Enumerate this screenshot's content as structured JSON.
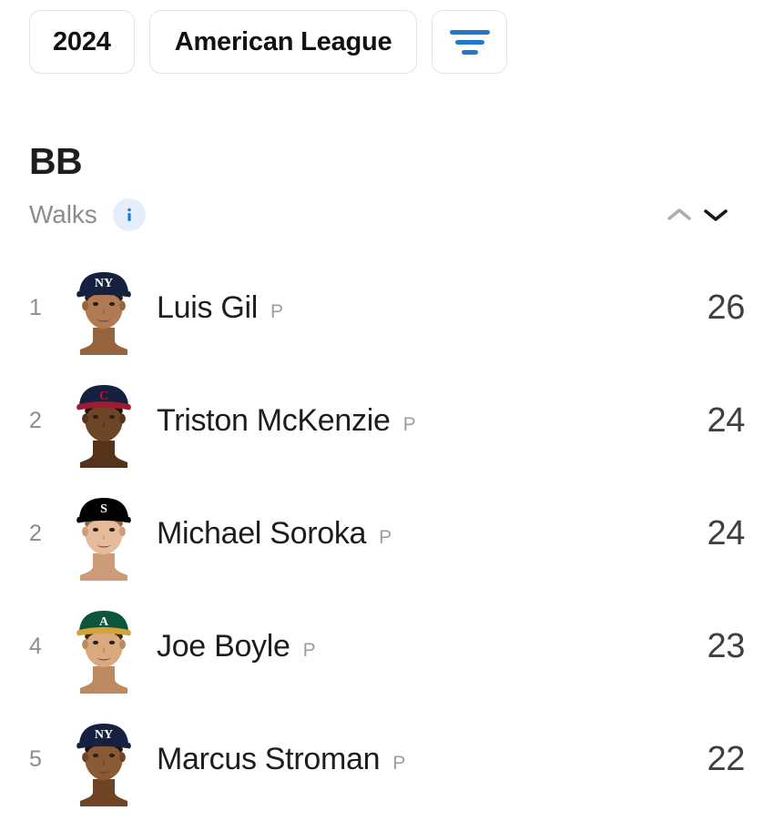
{
  "filters": {
    "season": "2024",
    "league": "American League",
    "filter_icon": "filter-icon"
  },
  "stat": {
    "abbr": "BB",
    "name": "Walks",
    "info_icon": "info-icon",
    "sort_asc_icon": "chevron-up-icon",
    "sort_desc_icon": "chevron-down-icon"
  },
  "leaders": [
    {
      "rank": "1",
      "name": "Luis Gil",
      "position": "P",
      "value": "26",
      "team": "New York Yankees",
      "cap": {
        "crown": "#16213f",
        "brim": "#16213f",
        "logo": "#ffffff",
        "logo_text": "NY"
      },
      "skin": "#b07a53",
      "skin_shadow": "#96643f",
      "hair": "#2b1d14"
    },
    {
      "rank": "2",
      "name": "Triston McKenzie",
      "position": "P",
      "value": "24",
      "team": "Cleveland Guardians",
      "cap": {
        "crown": "#16213f",
        "brim": "#9e1b32",
        "logo": "#c8102e",
        "logo_text": "C"
      },
      "skin": "#6d4527",
      "skin_shadow": "#55331b",
      "hair": "#1a1008"
    },
    {
      "rank": "2",
      "name": "Michael Soroka",
      "position": "P",
      "value": "24",
      "team": "Chicago White Sox",
      "cap": {
        "crown": "#000000",
        "brim": "#000000",
        "logo": "#ffffff",
        "logo_text": "S"
      },
      "skin": "#e6bb9c",
      "skin_shadow": "#cc9b79",
      "hair": "#8a6a44"
    },
    {
      "rank": "4",
      "name": "Joe Boyle",
      "position": "P",
      "value": "23",
      "team": "Oakland Athletics",
      "cap": {
        "crown": "#0c543a",
        "brim": "#d2a33a",
        "logo": "#ffffff",
        "logo_text": "A"
      },
      "skin": "#d9a97f",
      "skin_shadow": "#bb8a60",
      "hair": "#3a2516"
    },
    {
      "rank": "5",
      "name": "Marcus Stroman",
      "position": "P",
      "value": "22",
      "team": "New York Yankees",
      "cap": {
        "crown": "#16213f",
        "brim": "#16213f",
        "logo": "#ffffff",
        "logo_text": "NY"
      },
      "skin": "#8a5a34",
      "skin_shadow": "#6e4424",
      "hair": "#19110a"
    }
  ],
  "colors": {
    "accent_blue": "#2278cf",
    "info_bg": "#e4eefb",
    "muted": "#8a8d91",
    "text": "#1c1d1f"
  }
}
